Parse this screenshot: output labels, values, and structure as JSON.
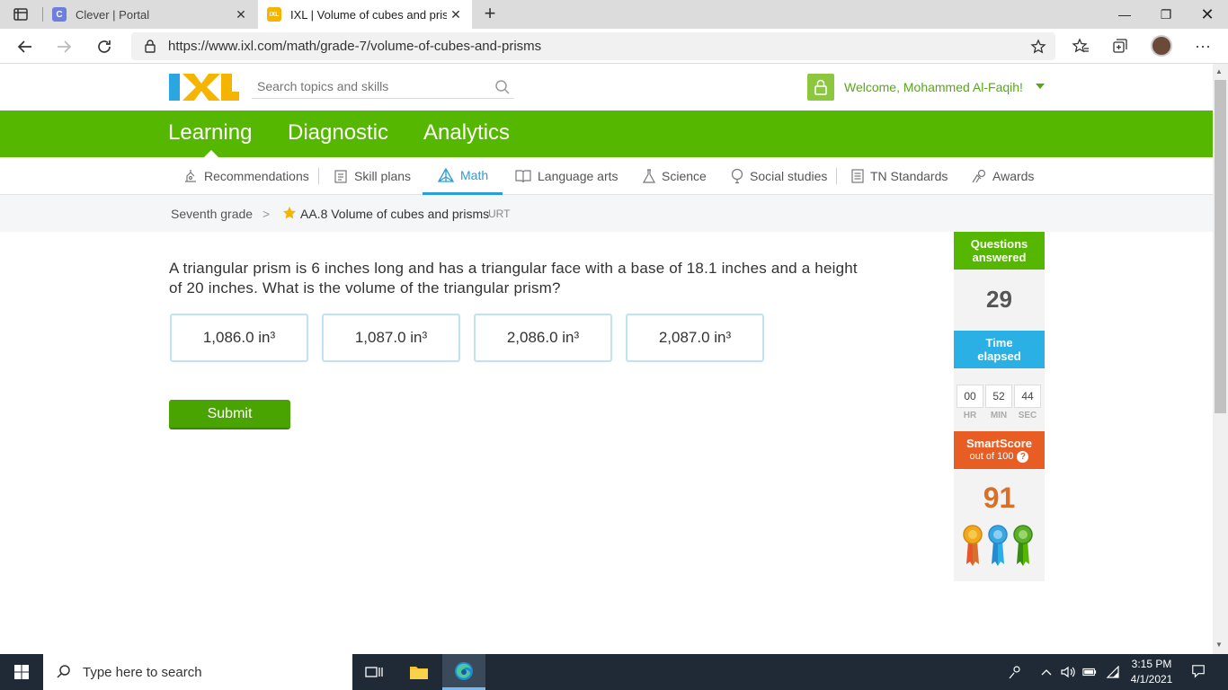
{
  "browser": {
    "tabs": [
      {
        "title": "Clever | Portal",
        "favicon_letter": "C",
        "favicon_color": "#6e7ee0"
      },
      {
        "title": "IXL | Volume of cubes and prisms",
        "favicon_letter": "IXL",
        "favicon_color": "#f4b400"
      }
    ],
    "url": "https://www.ixl.com/math/grade-7/volume-of-cubes-and-prisms"
  },
  "header": {
    "search_placeholder": "Search topics and skills",
    "welcome": "Welcome, Mohammed Al-Faqih!"
  },
  "main_nav": [
    "Learning",
    "Diagnostic",
    "Analytics"
  ],
  "subject_nav": [
    {
      "label": "Recommendations",
      "icon": "recommendations-icon"
    },
    {
      "label": "Skill plans",
      "icon": "skill-plans-icon"
    },
    {
      "label": "Math",
      "icon": "math-icon",
      "active": true
    },
    {
      "label": "Language arts",
      "icon": "book-icon"
    },
    {
      "label": "Science",
      "icon": "flask-icon"
    },
    {
      "label": "Social studies",
      "icon": "balloon-icon"
    },
    {
      "label": "TN Standards",
      "icon": "standards-icon"
    },
    {
      "label": "Awards",
      "icon": "awards-icon"
    }
  ],
  "breadcrumb": {
    "grade": "Seventh grade",
    "skill": "AA.8 Volume of cubes and prisms",
    "code": "URT"
  },
  "question": {
    "text": "A triangular prism is 6 inches long and has a triangular face with a base of 18.1 inches and a height of 20 inches. What is the volume of the triangular prism?",
    "choices": [
      "1,086.0 in³",
      "1,087.0 in³",
      "2,086.0 in³",
      "2,087.0 in³"
    ],
    "submit_label": "Submit"
  },
  "stats": {
    "questions_answered_label_1": "Questions",
    "questions_answered_label_2": "answered",
    "questions_answered": "29",
    "time_label_1": "Time",
    "time_label_2": "elapsed",
    "time": {
      "hr": "00",
      "min": "52",
      "sec": "44"
    },
    "time_units": {
      "hr": "HR",
      "min": "MIN",
      "sec": "SEC"
    },
    "smartscore_label": "SmartScore",
    "smartscore_sub": "out of 100",
    "smartscore_help": "?",
    "smartscore": "91"
  },
  "taskbar": {
    "search_placeholder": "Type here to search",
    "time": "3:15 PM",
    "date": "4/1/2021"
  },
  "colors": {
    "ixl_green": "#56b700",
    "time_blue": "#2ab0e4",
    "smartscore_orange": "#e85d24",
    "active_blue": "#2a9ed8"
  }
}
